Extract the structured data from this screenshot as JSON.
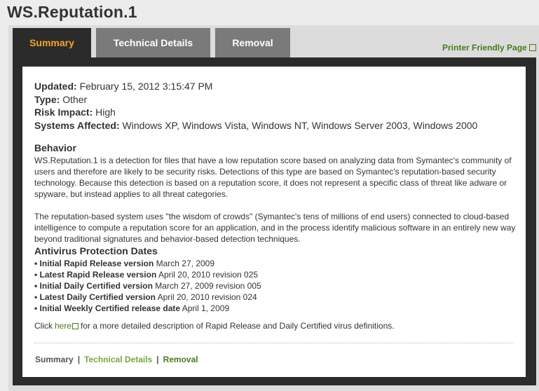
{
  "page": {
    "title": "WS.Reputation.1"
  },
  "tabs": [
    {
      "label": "Summary"
    },
    {
      "label": "Technical Details"
    },
    {
      "label": "Removal"
    }
  ],
  "printer_link": "Printer Friendly Page",
  "meta": {
    "updated_label": "Updated:",
    "updated_value": "February 15, 2012 3:15:47 PM",
    "type_label": "Type:",
    "type_value": "Other",
    "risk_label": "Risk Impact:",
    "risk_value": "High",
    "systems_label": "Systems Affected:",
    "systems_value": "Windows XP, Windows Vista, Windows NT, Windows Server 2003, Windows 2000"
  },
  "behavior": {
    "heading": "Behavior",
    "para1": "WS.Reputation.1 is a detection for files that have a low reputation score based on analyzing data from Symantec's community of users and therefore are likely to be security risks. Detections of this type are based on Symantec's reputation-based security technology. Because this detection is based on a reputation score, it does not represent a specific class of threat like adware or spyware, but instead applies to all threat categories.",
    "para2": "The reputation-based system uses \"the wisdom of crowds\" (Symantec's tens of millions of end users) connected to cloud-based intelligence to compute a reputation score for an application, and in the process identify malicious software in an entirely new way beyond traditional signatures and behavior-based detection techniques."
  },
  "dates": {
    "heading": "Antivirus Protection Dates",
    "items": [
      {
        "label": "Initial Rapid Release version",
        "value": "March 27, 2009"
      },
      {
        "label": "Latest Rapid Release version",
        "value": "April 20, 2010 revision 025"
      },
      {
        "label": "Initial Daily Certified version",
        "value": "March 27, 2009 revision 005"
      },
      {
        "label": "Latest Daily Certified version",
        "value": "April 20, 2010 revision 024"
      },
      {
        "label": "Initial Weekly Certified release date",
        "value": "April 1, 2009"
      }
    ]
  },
  "click_line": {
    "prefix": "Click",
    "link": "here",
    "suffix": "for a more detailed description of Rapid Release and Daily Certified virus definitions."
  },
  "bottom_nav": {
    "summary": "Summary",
    "technical": "Technical Details",
    "removal": "Removal",
    "separator": "|"
  },
  "colors": {
    "accent": "#f5a623",
    "link": "#4a7a1e",
    "tab_bg": "#7a7a7a",
    "frame": "#2b2b2b"
  }
}
